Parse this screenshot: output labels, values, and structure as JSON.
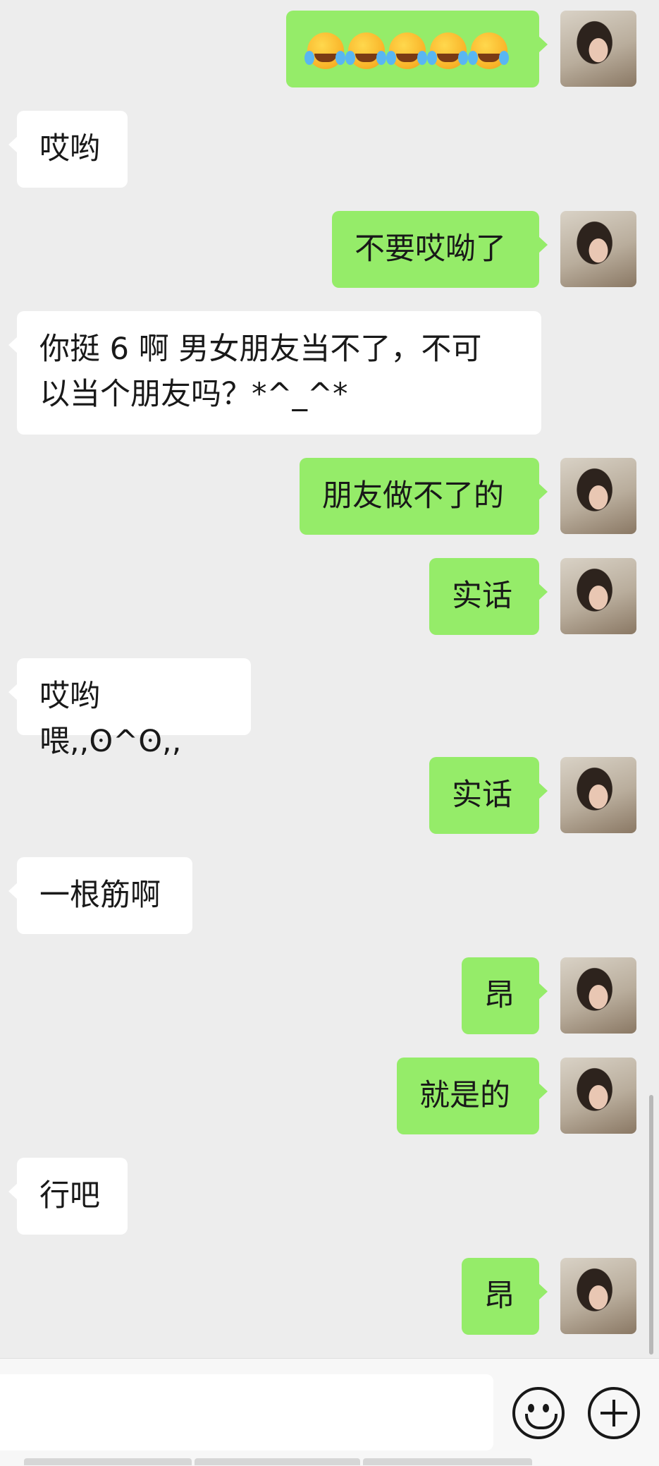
{
  "messages": [
    {
      "side": "out",
      "emoji_count": 5,
      "emoji_name": "loudly-crying-emoji"
    },
    {
      "side": "in",
      "text": "哎哟"
    },
    {
      "side": "out",
      "text": "不要哎呦了"
    },
    {
      "side": "in",
      "lines": [
        "你挺 6 啊   男女朋友当不了，不可",
        "以当个朋友吗？*^_^*"
      ]
    },
    {
      "side": "out",
      "text": "朋友做不了的"
    },
    {
      "side": "out",
      "text": "实话"
    },
    {
      "side": "in",
      "text": "哎哟喂,,ʘ^ʘ,,"
    },
    {
      "side": "out",
      "text": "实话"
    },
    {
      "side": "in",
      "text": "一根筋啊"
    },
    {
      "side": "out",
      "text": "昂"
    },
    {
      "side": "out",
      "text": "就是的"
    },
    {
      "side": "in",
      "text": "行吧"
    },
    {
      "side": "out",
      "text": "昂"
    }
  ],
  "icons": {
    "emoji_button": "smiley-face-icon",
    "more_button": "plus-circle-icon"
  },
  "colors": {
    "background": "#ededed",
    "outgoing_bubble": "#95ec69",
    "incoming_bubble": "#ffffff"
  }
}
